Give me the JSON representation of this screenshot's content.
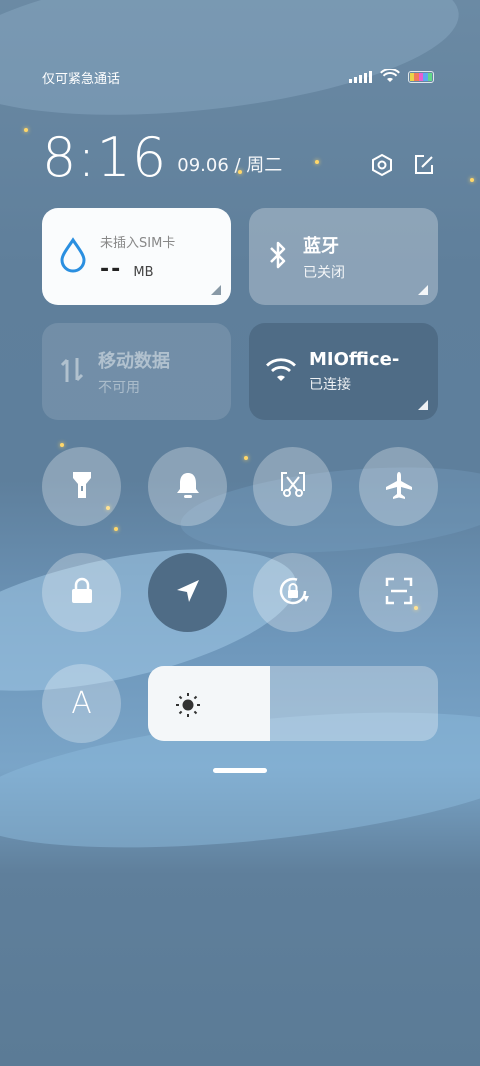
{
  "status": {
    "carrier_text": "仅可紧急通话"
  },
  "clock": {
    "time": "8:16",
    "date": "09.06 / 周二"
  },
  "tiles": {
    "data_usage": {
      "label": "未插入SIM卡",
      "value": "--",
      "unit": "MB"
    },
    "bluetooth": {
      "title": "蓝牙",
      "status": "已关闭"
    },
    "mobile_data": {
      "title": "移动数据",
      "status": "不可用"
    },
    "wifi": {
      "title": "MIOffice-",
      "status": "已连接"
    }
  },
  "toggles": {
    "row1": [
      "flashlight-icon",
      "bell-icon",
      "screenshot-scissors-icon",
      "airplane-icon"
    ],
    "row2": [
      "lock-icon",
      "location-icon",
      "rotation-lock-icon",
      "scan-icon"
    ],
    "font_button_label": "A"
  },
  "brightness": {
    "level": 0.42
  },
  "colors": {
    "accent_water": "#2a8fe0",
    "active_tile": "#4f6c86"
  }
}
